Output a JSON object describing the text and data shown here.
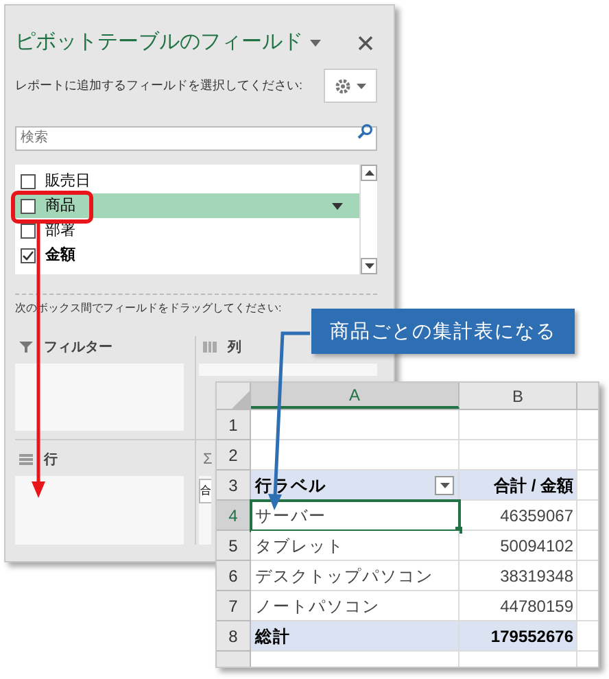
{
  "field_pane": {
    "title": "ピボットテーブルのフィールド",
    "subtitle": "レポートに追加するフィールドを選択してください:",
    "search": {
      "placeholder": "検索"
    },
    "fields": [
      {
        "label": "販売日",
        "checked": false,
        "selected": false
      },
      {
        "label": "商品",
        "checked": false,
        "selected": true
      },
      {
        "label": "部署",
        "checked": false,
        "selected": false
      },
      {
        "label": "金額",
        "checked": true,
        "selected": false
      }
    ],
    "drag_hint": "次のボックス間でフィールドをドラッグしてください:",
    "areas": [
      {
        "kind": "filter",
        "label": "フィルター"
      },
      {
        "kind": "columns",
        "label": "列"
      },
      {
        "kind": "rows",
        "label": "行"
      },
      {
        "kind": "values",
        "label": "Σ",
        "chips": [
          "合"
        ]
      }
    ]
  },
  "callout": {
    "text": "商品ごとの集計表になる"
  },
  "sheet": {
    "columns": [
      {
        "label": "A",
        "selected": true
      },
      {
        "label": "B",
        "selected": false
      }
    ],
    "rows": [
      {
        "number": "1",
        "kind": "blank",
        "selected": false
      },
      {
        "number": "2",
        "kind": "blank",
        "selected": false
      },
      {
        "number": "3",
        "kind": "header",
        "label": "行ラベル",
        "value": "合計 / 金額",
        "selected": false
      },
      {
        "number": "4",
        "kind": "item",
        "label": "サーバー",
        "value": "46359067",
        "selected": true
      },
      {
        "number": "5",
        "kind": "item",
        "label": "タブレット",
        "value": "50094102",
        "selected": false
      },
      {
        "number": "6",
        "kind": "item",
        "label": "デスクトップパソコン",
        "value": "38319348",
        "selected": false
      },
      {
        "number": "7",
        "kind": "item",
        "label": "ノートパソコン",
        "value": "44780159",
        "selected": false
      },
      {
        "number": "8",
        "kind": "total",
        "label": "総計",
        "value": "179552676",
        "selected": false
      }
    ]
  }
}
